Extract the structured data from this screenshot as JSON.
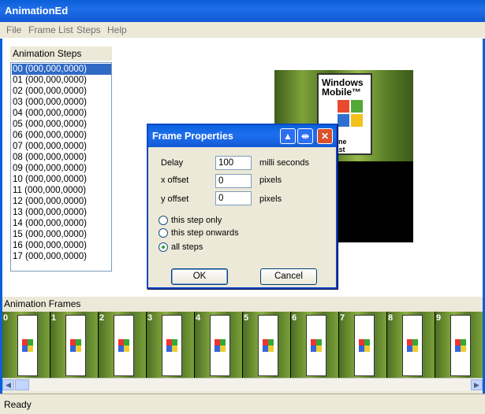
{
  "window": {
    "title": "AnimationEd"
  },
  "menu": [
    "File",
    "Frame List",
    "Steps",
    "Help"
  ],
  "steps_panel": {
    "label": "Animation Steps",
    "items": [
      "00 (000,000,0000)",
      "01 (000,000,0000)",
      "02 (000,000,0000)",
      "03 (000,000,0000)",
      "04 (000,000,0000)",
      "05 (000,000,0000)",
      "06 (000,000,0000)",
      "07 (000,000,0000)",
      "08 (000,000,0000)",
      "09 (000,000,0000)",
      "10 (000,000,0000)",
      "11 (000,000,0000)",
      "12 (000,000,0000)",
      "13 (000,000,0000)",
      "14 (000,000,0000)",
      "15 (000,000,0000)",
      "16 (000,000,0000)",
      "17 (000,000,0000)"
    ],
    "selected_index": 0
  },
  "preview": {
    "brand_line1": "Windows",
    "brand_line2": "Mobile™",
    "sub_line1": "rtphone",
    "sub_line2": "husiast"
  },
  "dialog": {
    "title": "Frame Properties",
    "fields": {
      "delay_label": "Delay",
      "delay_value": "100",
      "delay_unit": "milli seconds",
      "x_label": "x offset",
      "x_value": "0",
      "x_unit": "pixels",
      "y_label": "y offset",
      "y_value": "0",
      "y_unit": "pixels"
    },
    "radios": [
      {
        "label": "this step only",
        "checked": false
      },
      {
        "label": "this step onwards",
        "checked": false
      },
      {
        "label": "all steps",
        "checked": true
      }
    ],
    "ok": "OK",
    "cancel": "Cancel"
  },
  "frames_panel": {
    "label": "Animation Frames",
    "numbers": [
      "0",
      "1",
      "2",
      "3",
      "4",
      "5",
      "6",
      "7",
      "8",
      "9"
    ]
  },
  "scroll": {
    "left_glyph": "◀",
    "right_glyph": "▶"
  },
  "status": {
    "text": "Ready"
  },
  "colors": {
    "title_blue": "#0a5fd8",
    "selection": "#316ac5",
    "close_red": "#d9502a"
  }
}
